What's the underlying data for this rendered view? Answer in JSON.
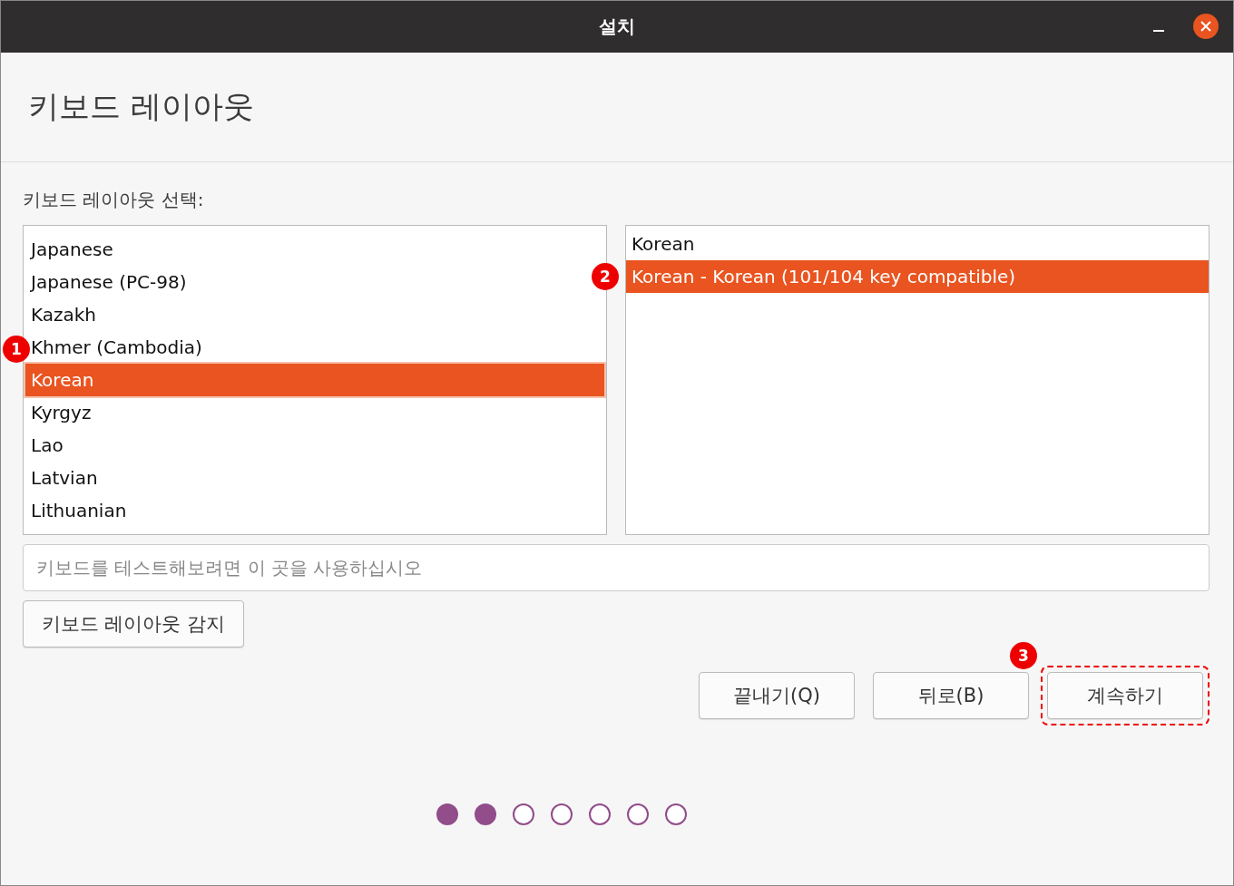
{
  "window": {
    "title": "설치"
  },
  "header": {
    "title": "키보드 레이아웃"
  },
  "layout_label": "키보드 레이아웃 선택:",
  "layouts": [
    {
      "label": "Japanese",
      "selected": false
    },
    {
      "label": "Japanese (PC-98)",
      "selected": false
    },
    {
      "label": "Kazakh",
      "selected": false
    },
    {
      "label": "Khmer (Cambodia)",
      "selected": false
    },
    {
      "label": "Korean",
      "selected": true
    },
    {
      "label": "Kyrgyz",
      "selected": false
    },
    {
      "label": "Lao",
      "selected": false
    },
    {
      "label": "Latvian",
      "selected": false
    },
    {
      "label": "Lithuanian",
      "selected": false
    }
  ],
  "variants": [
    {
      "label": "Korean",
      "selected": false
    },
    {
      "label": "Korean - Korean (101/104 key compatible)",
      "selected": true
    }
  ],
  "test_field": {
    "placeholder": "키보드를 테스트해보려면 이 곳을 사용하십시오"
  },
  "detect_button": "키보드 레이아웃 감지",
  "buttons": [
    {
      "label": "끝내기(Q)",
      "highlighted": false
    },
    {
      "label": "뒤로(B)",
      "highlighted": false
    },
    {
      "label": "계속하기",
      "highlighted": true
    }
  ],
  "steps": [
    {
      "done": true
    },
    {
      "done": true
    },
    {
      "done": false
    },
    {
      "done": false
    },
    {
      "done": false
    },
    {
      "done": false
    },
    {
      "done": false
    }
  ],
  "markers": [
    {
      "label": "1"
    },
    {
      "label": "2"
    },
    {
      "label": "3"
    }
  ]
}
